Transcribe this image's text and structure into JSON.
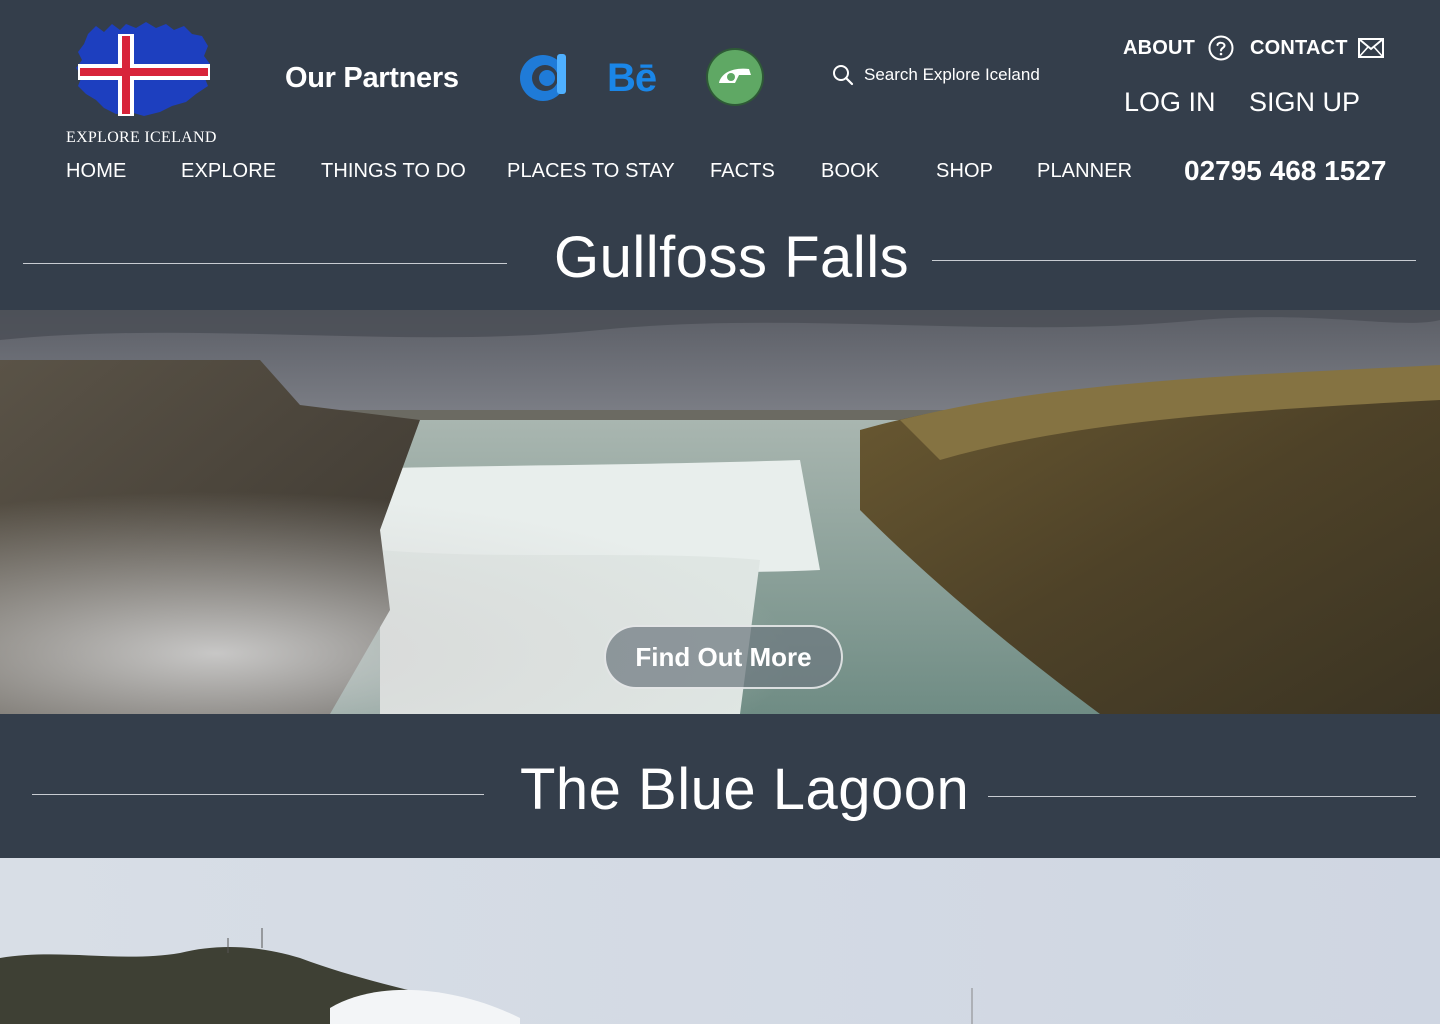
{
  "header": {
    "logo_text": "EXPLORE ICELAND",
    "partners_label": "Our Partners",
    "partners": [
      {
        "icon": "partner-c-icon",
        "color": "#1f7bd8"
      },
      {
        "icon": "behance-icon",
        "label": "Bē",
        "color": "#1a86e8"
      },
      {
        "icon": "deviantart-icon",
        "color": "#5fa864"
      }
    ],
    "search_placeholder": "Search Explore Iceland",
    "about": "ABOUT",
    "contact": "CONTACT",
    "login": "LOG IN",
    "signup": "SIGN UP",
    "phone": "02795 468 1527"
  },
  "nav": {
    "home": "HOME",
    "explore": "EXPLORE",
    "things_to_do": "THINGS TO DO",
    "places_to_stay": "PLACES TO STAY",
    "facts": "FACTS",
    "book": "BOOK",
    "shop": "SHOP",
    "planner": "PLANNER"
  },
  "sections": [
    {
      "title": "Gullfoss Falls",
      "button": "Find Out More"
    },
    {
      "title": "The Blue Lagoon"
    }
  ],
  "colors": {
    "background": "#343e4b",
    "flag_blue": "#1d3fbf",
    "flag_red": "#d8243a"
  }
}
